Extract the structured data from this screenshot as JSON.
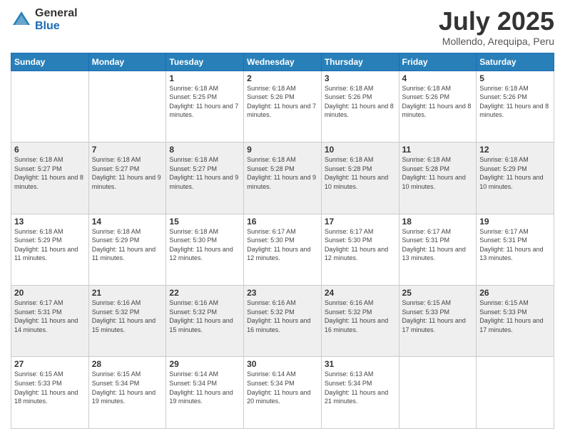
{
  "logo": {
    "general": "General",
    "blue": "Blue"
  },
  "header": {
    "month": "July 2025",
    "location": "Mollendo, Arequipa, Peru"
  },
  "weekdays": [
    "Sunday",
    "Monday",
    "Tuesday",
    "Wednesday",
    "Thursday",
    "Friday",
    "Saturday"
  ],
  "weeks": [
    [
      {
        "day": "",
        "sunrise": "",
        "sunset": "",
        "daylight": ""
      },
      {
        "day": "",
        "sunrise": "",
        "sunset": "",
        "daylight": ""
      },
      {
        "day": "1",
        "sunrise": "Sunrise: 6:18 AM",
        "sunset": "Sunset: 5:25 PM",
        "daylight": "Daylight: 11 hours and 7 minutes."
      },
      {
        "day": "2",
        "sunrise": "Sunrise: 6:18 AM",
        "sunset": "Sunset: 5:26 PM",
        "daylight": "Daylight: 11 hours and 7 minutes."
      },
      {
        "day": "3",
        "sunrise": "Sunrise: 6:18 AM",
        "sunset": "Sunset: 5:26 PM",
        "daylight": "Daylight: 11 hours and 8 minutes."
      },
      {
        "day": "4",
        "sunrise": "Sunrise: 6:18 AM",
        "sunset": "Sunset: 5:26 PM",
        "daylight": "Daylight: 11 hours and 8 minutes."
      },
      {
        "day": "5",
        "sunrise": "Sunrise: 6:18 AM",
        "sunset": "Sunset: 5:26 PM",
        "daylight": "Daylight: 11 hours and 8 minutes."
      }
    ],
    [
      {
        "day": "6",
        "sunrise": "Sunrise: 6:18 AM",
        "sunset": "Sunset: 5:27 PM",
        "daylight": "Daylight: 11 hours and 8 minutes."
      },
      {
        "day": "7",
        "sunrise": "Sunrise: 6:18 AM",
        "sunset": "Sunset: 5:27 PM",
        "daylight": "Daylight: 11 hours and 9 minutes."
      },
      {
        "day": "8",
        "sunrise": "Sunrise: 6:18 AM",
        "sunset": "Sunset: 5:27 PM",
        "daylight": "Daylight: 11 hours and 9 minutes."
      },
      {
        "day": "9",
        "sunrise": "Sunrise: 6:18 AM",
        "sunset": "Sunset: 5:28 PM",
        "daylight": "Daylight: 11 hours and 9 minutes."
      },
      {
        "day": "10",
        "sunrise": "Sunrise: 6:18 AM",
        "sunset": "Sunset: 5:28 PM",
        "daylight": "Daylight: 11 hours and 10 minutes."
      },
      {
        "day": "11",
        "sunrise": "Sunrise: 6:18 AM",
        "sunset": "Sunset: 5:28 PM",
        "daylight": "Daylight: 11 hours and 10 minutes."
      },
      {
        "day": "12",
        "sunrise": "Sunrise: 6:18 AM",
        "sunset": "Sunset: 5:29 PM",
        "daylight": "Daylight: 11 hours and 10 minutes."
      }
    ],
    [
      {
        "day": "13",
        "sunrise": "Sunrise: 6:18 AM",
        "sunset": "Sunset: 5:29 PM",
        "daylight": "Daylight: 11 hours and 11 minutes."
      },
      {
        "day": "14",
        "sunrise": "Sunrise: 6:18 AM",
        "sunset": "Sunset: 5:29 PM",
        "daylight": "Daylight: 11 hours and 11 minutes."
      },
      {
        "day": "15",
        "sunrise": "Sunrise: 6:18 AM",
        "sunset": "Sunset: 5:30 PM",
        "daylight": "Daylight: 11 hours and 12 minutes."
      },
      {
        "day": "16",
        "sunrise": "Sunrise: 6:17 AM",
        "sunset": "Sunset: 5:30 PM",
        "daylight": "Daylight: 11 hours and 12 minutes."
      },
      {
        "day": "17",
        "sunrise": "Sunrise: 6:17 AM",
        "sunset": "Sunset: 5:30 PM",
        "daylight": "Daylight: 11 hours and 12 minutes."
      },
      {
        "day": "18",
        "sunrise": "Sunrise: 6:17 AM",
        "sunset": "Sunset: 5:31 PM",
        "daylight": "Daylight: 11 hours and 13 minutes."
      },
      {
        "day": "19",
        "sunrise": "Sunrise: 6:17 AM",
        "sunset": "Sunset: 5:31 PM",
        "daylight": "Daylight: 11 hours and 13 minutes."
      }
    ],
    [
      {
        "day": "20",
        "sunrise": "Sunrise: 6:17 AM",
        "sunset": "Sunset: 5:31 PM",
        "daylight": "Daylight: 11 hours and 14 minutes."
      },
      {
        "day": "21",
        "sunrise": "Sunrise: 6:16 AM",
        "sunset": "Sunset: 5:32 PM",
        "daylight": "Daylight: 11 hours and 15 minutes."
      },
      {
        "day": "22",
        "sunrise": "Sunrise: 6:16 AM",
        "sunset": "Sunset: 5:32 PM",
        "daylight": "Daylight: 11 hours and 15 minutes."
      },
      {
        "day": "23",
        "sunrise": "Sunrise: 6:16 AM",
        "sunset": "Sunset: 5:32 PM",
        "daylight": "Daylight: 11 hours and 16 minutes."
      },
      {
        "day": "24",
        "sunrise": "Sunrise: 6:16 AM",
        "sunset": "Sunset: 5:32 PM",
        "daylight": "Daylight: 11 hours and 16 minutes."
      },
      {
        "day": "25",
        "sunrise": "Sunrise: 6:15 AM",
        "sunset": "Sunset: 5:33 PM",
        "daylight": "Daylight: 11 hours and 17 minutes."
      },
      {
        "day": "26",
        "sunrise": "Sunrise: 6:15 AM",
        "sunset": "Sunset: 5:33 PM",
        "daylight": "Daylight: 11 hours and 17 minutes."
      }
    ],
    [
      {
        "day": "27",
        "sunrise": "Sunrise: 6:15 AM",
        "sunset": "Sunset: 5:33 PM",
        "daylight": "Daylight: 11 hours and 18 minutes."
      },
      {
        "day": "28",
        "sunrise": "Sunrise: 6:15 AM",
        "sunset": "Sunset: 5:34 PM",
        "daylight": "Daylight: 11 hours and 19 minutes."
      },
      {
        "day": "29",
        "sunrise": "Sunrise: 6:14 AM",
        "sunset": "Sunset: 5:34 PM",
        "daylight": "Daylight: 11 hours and 19 minutes."
      },
      {
        "day": "30",
        "sunrise": "Sunrise: 6:14 AM",
        "sunset": "Sunset: 5:34 PM",
        "daylight": "Daylight: 11 hours and 20 minutes."
      },
      {
        "day": "31",
        "sunrise": "Sunrise: 6:13 AM",
        "sunset": "Sunset: 5:34 PM",
        "daylight": "Daylight: 11 hours and 21 minutes."
      },
      {
        "day": "",
        "sunrise": "",
        "sunset": "",
        "daylight": ""
      },
      {
        "day": "",
        "sunrise": "",
        "sunset": "",
        "daylight": ""
      }
    ]
  ]
}
